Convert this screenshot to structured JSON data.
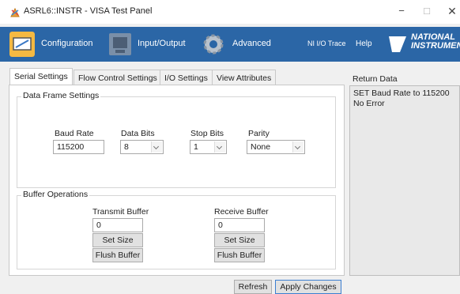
{
  "window": {
    "title": "ASRL6::INSTR - VISA Test Panel",
    "minimize": "−",
    "maximize": "□",
    "close": "✕"
  },
  "toolbar": {
    "configuration": "Configuration",
    "input_output": "Input/Output",
    "advanced": "Advanced",
    "ni_io_trace": "NI I/O Trace",
    "help": "Help",
    "logo_line1": "NATIONAL",
    "logo_line2": "INSTRUMENTS"
  },
  "tabs": [
    {
      "label": "Serial Settings",
      "active": true
    },
    {
      "label": "Flow Control Settings",
      "active": false
    },
    {
      "label": "I/O Settings",
      "active": false
    },
    {
      "label": "View Attributes",
      "active": false
    }
  ],
  "data_frame": {
    "title": "Data Frame Settings",
    "baud_rate_label": "Baud Rate",
    "baud_rate_value": "115200",
    "data_bits_label": "Data Bits",
    "data_bits_value": "8",
    "stop_bits_label": "Stop Bits",
    "stop_bits_value": "1",
    "parity_label": "Parity",
    "parity_value": "None"
  },
  "buffer_ops": {
    "title": "Buffer Operations",
    "transmit_label": "Transmit Buffer",
    "transmit_value": "0",
    "receive_label": "Receive Buffer",
    "receive_value": "0",
    "set_size": "Set Size",
    "flush_buffer": "Flush Buffer"
  },
  "return_data": {
    "label": "Return Data",
    "line1": "SET Baud Rate to 115200",
    "line2": "No Error"
  },
  "footer": {
    "refresh": "Refresh",
    "apply": "Apply Changes"
  },
  "colors": {
    "toolbar": "#2b66a6",
    "primary_border": "#3c7fd1"
  }
}
